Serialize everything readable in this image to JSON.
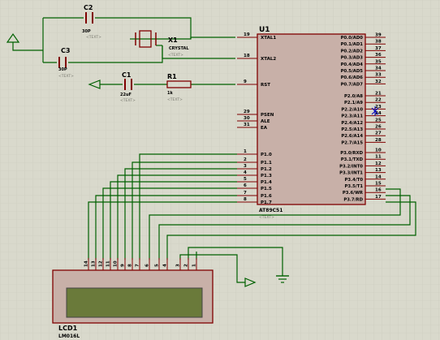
{
  "schematic": {
    "colors": {
      "background": "#d9d9cc",
      "grid": "#c9c9bb",
      "wire": "#006000",
      "component": "#800000",
      "chip_fill": "#c8b0a8",
      "label": "#000000",
      "placeholder": "#7a7a70",
      "pin_number": "#000000",
      "lcd_screen": "#6a7a3a",
      "probe": "#0000c0"
    },
    "c2": {
      "ref": "C2",
      "value": "30P",
      "text": "<TEXT>"
    },
    "c3": {
      "ref": "C3",
      "value": "30P",
      "text": "<TEXT>"
    },
    "x1": {
      "ref": "X1",
      "value": "CRYSTAL",
      "text": "<TEXT>"
    },
    "c1": {
      "ref": "C1",
      "value": "22uF",
      "text": "<TEXT>"
    },
    "r1": {
      "ref": "R1",
      "value": "1k",
      "text": "<TEXT>"
    },
    "u1": {
      "ref": "U1",
      "part": "AT89C51",
      "text": "<TEXT>",
      "left_pins": [
        {
          "num": "19",
          "name": "XTAL1"
        },
        {
          "num": "18",
          "name": "XTAL2"
        },
        {
          "num": "9",
          "name": "RST"
        },
        {
          "num": "29",
          "name": "PSEN"
        },
        {
          "num": "30",
          "name": "ALE"
        },
        {
          "num": "31",
          "name": "EA"
        },
        {
          "num": "1",
          "name": "P1.0"
        },
        {
          "num": "2",
          "name": "P1.1"
        },
        {
          "num": "3",
          "name": "P1.2"
        },
        {
          "num": "4",
          "name": "P1.3"
        },
        {
          "num": "5",
          "name": "P1.4"
        },
        {
          "num": "6",
          "name": "P1.5"
        },
        {
          "num": "7",
          "name": "P1.6"
        },
        {
          "num": "8",
          "name": "P1.7"
        }
      ],
      "right_pins": [
        {
          "num": "39",
          "name": "P0.0/AD0"
        },
        {
          "num": "38",
          "name": "P0.1/AD1"
        },
        {
          "num": "37",
          "name": "P0.2/AD2"
        },
        {
          "num": "36",
          "name": "P0.3/AD3"
        },
        {
          "num": "35",
          "name": "P0.4/AD4"
        },
        {
          "num": "34",
          "name": "P0.5/AD5"
        },
        {
          "num": "33",
          "name": "P0.6/AD6"
        },
        {
          "num": "32",
          "name": "P0.7/AD7"
        },
        {
          "num": "21",
          "name": "P2.0/A8"
        },
        {
          "num": "22",
          "name": "P2.1/A9"
        },
        {
          "num": "23",
          "name": "P2.2/A10"
        },
        {
          "num": "24",
          "name": "P2.3/A11"
        },
        {
          "num": "25",
          "name": "P2.4/A12"
        },
        {
          "num": "26",
          "name": "P2.5/A13"
        },
        {
          "num": "27",
          "name": "P2.6/A14"
        },
        {
          "num": "28",
          "name": "P2.7/A15"
        },
        {
          "num": "10",
          "name": "P3.0/RXD"
        },
        {
          "num": "11",
          "name": "P3.1/TXD"
        },
        {
          "num": "12",
          "name": "P3.2/INT0"
        },
        {
          "num": "13",
          "name": "P3.3/INT1"
        },
        {
          "num": "14",
          "name": "P3.4/T0"
        },
        {
          "num": "15",
          "name": "P3.5/T1"
        },
        {
          "num": "16",
          "name": "P3.6/WR"
        },
        {
          "num": "17",
          "name": "P3.7/RD"
        }
      ]
    },
    "lcd": {
      "ref": "LCD1",
      "part": "LM016L",
      "pins": [
        {
          "num": "14",
          "name": "D7"
        },
        {
          "num": "13",
          "name": "D6"
        },
        {
          "num": "12",
          "name": "D5"
        },
        {
          "num": "11",
          "name": "D4"
        },
        {
          "num": "10",
          "name": "D3"
        },
        {
          "num": "9",
          "name": "D2"
        },
        {
          "num": "8",
          "name": "D1"
        },
        {
          "num": "7",
          "name": "D0"
        },
        {
          "num": "6",
          "name": "E"
        },
        {
          "num": "5",
          "name": "RW"
        },
        {
          "num": "4",
          "name": "RS"
        },
        {
          "num": "3",
          "name": "VEE"
        },
        {
          "num": "2",
          "name": "VDD"
        },
        {
          "num": "1",
          "name": "VSS"
        }
      ]
    }
  }
}
